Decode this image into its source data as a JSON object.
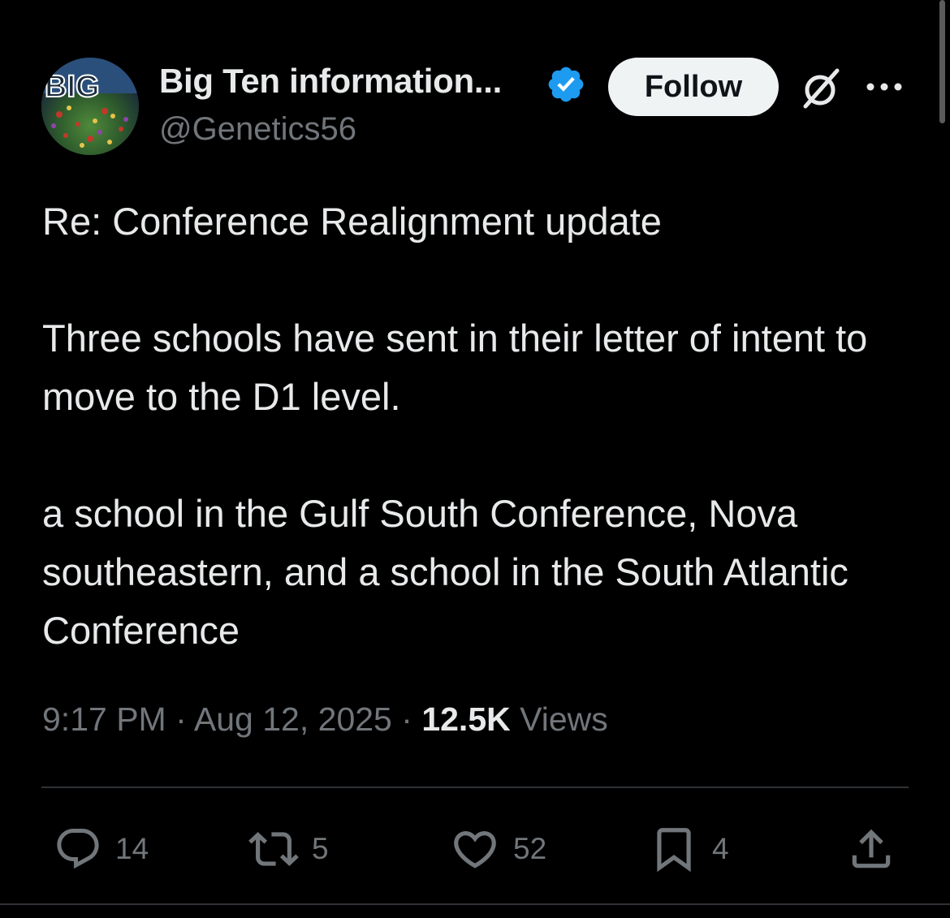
{
  "author": {
    "display_name": "Big Ten information...",
    "handle": "@Genetics56",
    "avatar_text": "BIG",
    "verified": true
  },
  "header": {
    "follow_label": "Follow"
  },
  "tweet": {
    "text": "Re: Conference Realignment update\n\nThree schools have sent in their letter of intent to move to the D1 level.\n\na school in the Gulf South Conference, Nova southeastern, and a school in the South Atlantic Conference",
    "time": "9:17 PM",
    "separator": "·",
    "date": "Aug 12, 2025",
    "views_count": "12.5K",
    "views_label": "Views"
  },
  "actions": {
    "replies": "14",
    "reposts": "5",
    "likes": "52",
    "bookmarks": "4"
  },
  "colors": {
    "background": "#000000",
    "text_primary": "#e7e9ea",
    "text_secondary": "#71767b",
    "verified_blue": "#1d9bf0",
    "follow_bg": "#eff3f4",
    "divider": "#2f3336"
  }
}
